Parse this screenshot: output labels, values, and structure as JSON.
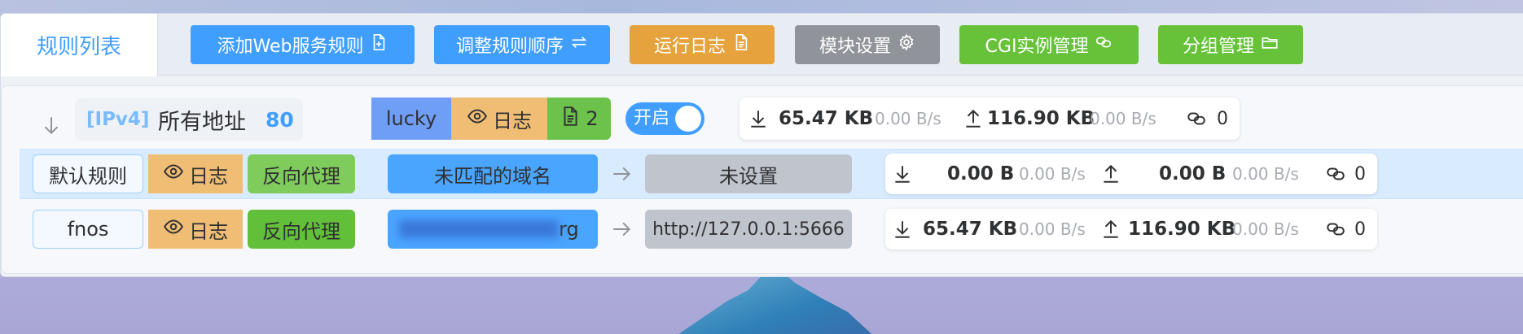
{
  "tabs": {
    "active_label": "规则列表"
  },
  "toolbar": [
    {
      "name": "add-web-rule-button",
      "label": "添加Web服务规则",
      "icon": "file-plus-icon",
      "color": "#409eff"
    },
    {
      "name": "reorder-rules-button",
      "label": "调整规则顺序",
      "icon": "swap-arrows-icon",
      "color": "#409eff"
    },
    {
      "name": "run-log-button",
      "label": "运行日志",
      "icon": "document-icon",
      "color": "#e6a23c"
    },
    {
      "name": "module-settings-button",
      "label": "模块设置",
      "icon": "gear-icon",
      "color": "#909399"
    },
    {
      "name": "cgi-manage-button",
      "label": "CGI实例管理",
      "icon": "link-icon",
      "color": "#67c23a"
    },
    {
      "name": "group-manage-button",
      "label": "分组管理",
      "icon": "folder-icon",
      "color": "#67c23a"
    }
  ],
  "listener": {
    "protocol": "[IPv4]",
    "address": "所有地址",
    "port": "80",
    "name": "lucky",
    "log_label": "日志",
    "doc_count": "2",
    "toggle_label": "开启",
    "enabled": true,
    "stats": {
      "down_total": "65.47 KB",
      "down_rate": "0.00 B/s",
      "up_total": "116.90 KB",
      "up_rate": "0.00 B/s",
      "connections": "0"
    }
  },
  "rules": [
    {
      "name": "默认规则",
      "log_label": "日志",
      "type": "反向代理",
      "domain": "未匹配的域名",
      "target": "未设置",
      "stats": {
        "down_total": "0.00 B",
        "down_rate": "0.00 B/s",
        "up_total": "0.00 B",
        "up_rate": "0.00 B/s",
        "connections": "0"
      }
    },
    {
      "name": "fnos",
      "log_label": "日志",
      "type": "反向代理",
      "domain_suffix": "rg",
      "target": "http://127.0.0.1:5666",
      "stats": {
        "down_total": "65.47 KB",
        "down_rate": "0.00 B/s",
        "up_total": "116.90 KB",
        "up_rate": "0.00 B/s",
        "connections": "0"
      }
    }
  ]
}
